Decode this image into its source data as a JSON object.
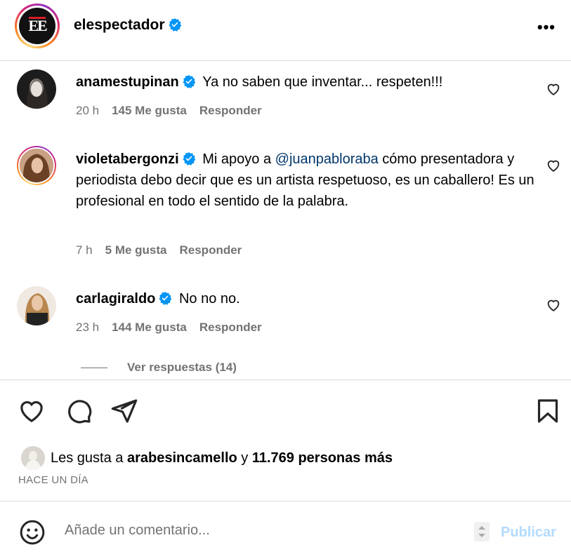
{
  "header": {
    "username": "elespectador",
    "avatar_text": "EE",
    "more_label": "•••"
  },
  "comments": [
    {
      "username": "anamestupinan",
      "text": "Ya no saben que inventar... respeten!!!",
      "time": "20 h",
      "likes": "145 Me gusta",
      "reply": "Responder"
    },
    {
      "username": "violetabergonzi",
      "text_before": "Mi apoyo a ",
      "mention": "@juanpabloraba",
      "text_after": " cómo presentadora y periodista debo decir que es un artista respetuoso, es un caballero! Es un profesional en todo el sentido de la palabra.",
      "time": "7 h",
      "likes": "5 Me gusta",
      "reply": "Responder"
    },
    {
      "username": "carlagiraldo",
      "text": "No no no.",
      "time": "23 h",
      "likes": "144 Me gusta",
      "reply": "Responder"
    }
  ],
  "view_replies": "Ver respuestas (14)",
  "likes_line": {
    "prefix": "Les gusta a ",
    "user": "arabesincamello",
    "middle": " y ",
    "count": "11.769 personas más"
  },
  "timestamp": "HACE UN DÍA",
  "comment_box": {
    "placeholder": "Añade un comentario...",
    "publish": "Publicar"
  },
  "colors": {
    "verified": "#0095f6",
    "mention": "#00376b",
    "muted": "#737373",
    "publish_disabled": "#b3dbff"
  }
}
